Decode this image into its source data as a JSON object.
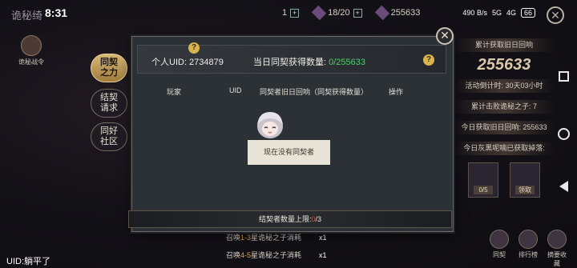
{
  "status_bar": {
    "time": "8:31",
    "app_title": "诡秘绮",
    "net_speed": "490 B/s",
    "signal_labels": [
      "5G",
      "4G"
    ],
    "battery": "66"
  },
  "resources": {
    "item1_count": "1",
    "stamina": "18/20",
    "currency": "255633"
  },
  "left_badge": {
    "label": "诡秘战令"
  },
  "side_tabs": [
    {
      "label_line1": "同契",
      "label_line2": "之力",
      "active": true
    },
    {
      "label_line1": "结契",
      "label_line2": "请求",
      "active": false
    },
    {
      "label_line1": "同好",
      "label_line2": "社区",
      "active": false
    }
  ],
  "dialog": {
    "uid_label": "个人UID: 2734879",
    "today_label": "当日同契获得数量:",
    "today_value": "0/255633",
    "help_q": "?",
    "columns": [
      "玩家",
      "UID",
      "同契者旧日回响（同契获得数量）",
      "操作"
    ],
    "empty_text": "现在没有同契者",
    "footer_prefix": "结契者数量上限:",
    "footer_current": "0",
    "footer_max": "/3",
    "close_symbol": "✕"
  },
  "right_panel": {
    "total_label": "累计获取旧日回响",
    "total_value": "255633",
    "countdown": "活动倒计时: 30天03小时",
    "defeated": "累计击败诡秘之子: 7",
    "today_gain": "今日获取旧日回响: 255633",
    "today_drop_label": "今日灰黑呢喃已获取掉落:",
    "item_tags": [
      "0/5",
      "领取"
    ],
    "buttons": [
      "同契",
      "排行榜",
      "摘要收藏"
    ]
  },
  "bottom": {
    "uid_line": "UID:躺平了",
    "summon1_pre": "召唤",
    "summon1_hl": "1-3",
    "summon1_post": "星诡秘之子消耗",
    "summon1_count": "x1",
    "summon2_pre": "召唤",
    "summon2_hl": "4-5",
    "summon2_post": "星诡秘之子消耗",
    "summon2_count": "x1"
  },
  "top_close_symbol": "✕",
  "colors": {
    "accent_gold": "#d6b976",
    "green_value": "#4fcf6c",
    "red_value": "#e54a3a"
  }
}
